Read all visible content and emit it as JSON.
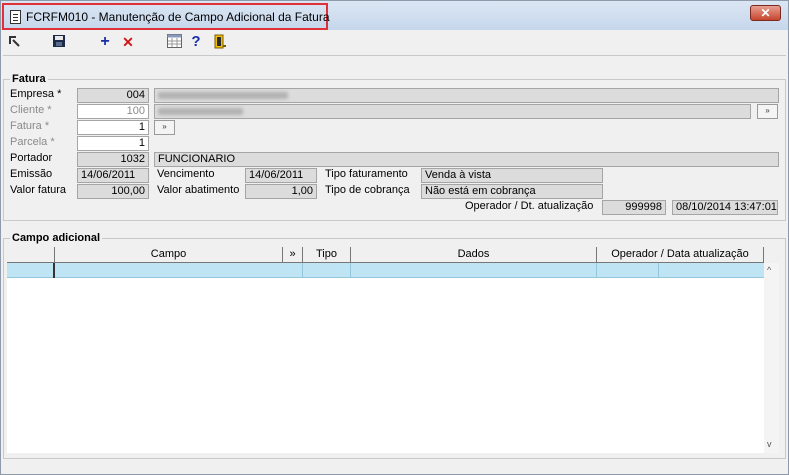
{
  "window": {
    "title": "FCRFM010 - Manutenção de Campo Adicional da Fatura",
    "close_glyph": "✕"
  },
  "toolbar": {
    "items": [
      {
        "name": "exit-icon",
        "glyph": "⇱"
      },
      {
        "name": "save-icon",
        "glyph": "▪"
      },
      {
        "name": "add-icon",
        "glyph": "+"
      },
      {
        "name": "delete-icon",
        "glyph": "✕"
      },
      {
        "name": "calendar-icon",
        "glyph": "▦"
      },
      {
        "name": "help-icon",
        "glyph": "?"
      },
      {
        "name": "door-exit-icon",
        "glyph": "▯"
      }
    ]
  },
  "fatura": {
    "legend": "Fatura",
    "empresa_label": "Empresa *",
    "empresa_value": "004",
    "cliente_label": "Cliente *",
    "cliente_value": "100",
    "fatura_label": "Fatura *",
    "fatura_value": "1",
    "parcela_label": "Parcela *",
    "parcela_value": "1",
    "portador_label": "Portador",
    "portador_value": "1032",
    "portador_desc": "FUNCIONARIO",
    "emissao_label": "Emissão",
    "emissao_value": "14/06/2011",
    "vencimento_label": "Vencimento",
    "vencimento_value": "14/06/2011",
    "tipo_faturamento_label": "Tipo faturamento",
    "tipo_faturamento_value": "Venda à vista",
    "valor_fatura_label": "Valor fatura",
    "valor_fatura_value": "100,00",
    "valor_abatimento_label": "Valor abatimento",
    "valor_abatimento_value": "1,00",
    "tipo_cobranca_label": "Tipo de cobrança",
    "tipo_cobranca_value": "Não está em cobrança",
    "operador_label": "Operador / Dt. atualização",
    "operador_value": "999998",
    "dt_atualizacao_value": "08/10/2014 13:47:01",
    "lookup_glyph": "»"
  },
  "campo_adicional": {
    "legend": "Campo adicional",
    "columns": [
      "Campo",
      "»",
      "Tipo",
      "Dados",
      "Operador / Data atualização"
    ]
  },
  "colors": {
    "title_highlight": "#e0303a",
    "selected_row": "#bfe4f4"
  }
}
